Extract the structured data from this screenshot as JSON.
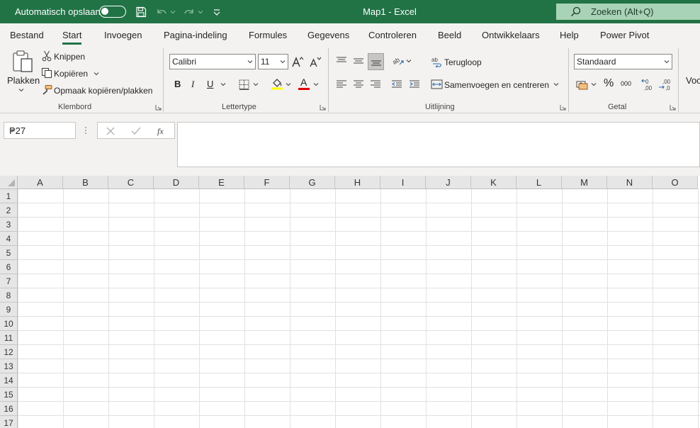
{
  "titlebar": {
    "autosave_label": "Automatisch opslaan",
    "autosave_state": "off",
    "document_title": "Map1  -  Excel",
    "search_placeholder": "Zoeken (Alt+Q)",
    "icons": [
      "save-icon",
      "undo-icon",
      "redo-icon",
      "customize-quick-access-icon",
      "search-icon"
    ]
  },
  "tabs": [
    {
      "label": "Bestand",
      "active": false
    },
    {
      "label": "Start",
      "active": true
    },
    {
      "label": "Invoegen",
      "active": false
    },
    {
      "label": "Pagina-indeling",
      "active": false
    },
    {
      "label": "Formules",
      "active": false
    },
    {
      "label": "Gegevens",
      "active": false
    },
    {
      "label": "Controleren",
      "active": false
    },
    {
      "label": "Beeld",
      "active": false
    },
    {
      "label": "Ontwikkelaars",
      "active": false
    },
    {
      "label": "Help",
      "active": false
    },
    {
      "label": "Power Pivot",
      "active": false
    }
  ],
  "ribbon": {
    "clipboard": {
      "group_label": "Klembord",
      "paste": "Plakken",
      "cut": "Knippen",
      "copy": "Kopiëren",
      "format_painter": "Opmaak kopiëren/plakken"
    },
    "font": {
      "group_label": "Lettertype",
      "font_name": "Calibri",
      "font_size": "11",
      "bold": "B",
      "italic": "I",
      "underline": "U",
      "font_color_letter": "A",
      "highlight_color": "#ffff00",
      "font_color": "#e00000"
    },
    "alignment": {
      "group_label": "Uitlijning",
      "wrap_text": "Terugloop",
      "merge_center": "Samenvoegen en centreren"
    },
    "number": {
      "group_label": "Getal",
      "format": "Standaard",
      "percent": "%",
      "thousands": "000"
    },
    "partial_next_group": "Voo"
  },
  "formula_bar": {
    "name_box": "P27",
    "formula": ""
  },
  "grid": {
    "columns": [
      "A",
      "B",
      "C",
      "D",
      "E",
      "F",
      "G",
      "H",
      "I",
      "J",
      "K",
      "L",
      "M",
      "N",
      "O"
    ],
    "rows": [
      "1",
      "2",
      "3",
      "4",
      "5",
      "6",
      "7",
      "8",
      "9",
      "10",
      "11",
      "12",
      "13",
      "14",
      "15",
      "16",
      "17"
    ]
  },
  "colors": {
    "brand": "#217346",
    "search_bg": "#a9d3b6",
    "ribbon_bg": "#f3f2f1"
  }
}
